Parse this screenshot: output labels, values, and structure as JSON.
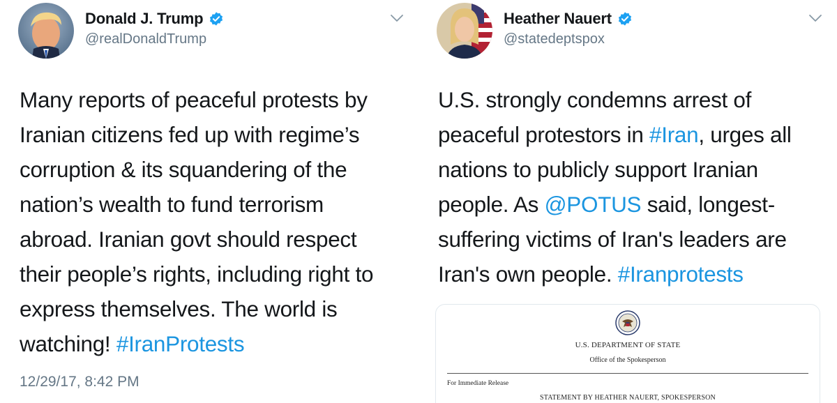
{
  "colors": {
    "link": "#1b95e0",
    "verified": "#1da1f2",
    "secondary_text": "#657786",
    "primary_text": "#14171a"
  },
  "left_tweet": {
    "display_name": "Donald J. Trump",
    "handle": "@realDonaldTrump",
    "avatar_icon": "profile-photo",
    "verified_icon": "verified-badge-icon",
    "menu_icon": "chevron-down-icon",
    "lines": [
      "Many reports of peaceful protests by",
      "Iranian citizens fed up with regime’s",
      "corruption & its squandering of the",
      "nation’s wealth to fund terrorism",
      "abroad. Iranian govt should respect",
      "their people’s rights, including right to",
      "express themselves. The world is",
      "watching!"
    ],
    "hashtag": "#IranProtests",
    "timestamp": "12/29/17, 8:42 PM"
  },
  "right_tweet": {
    "display_name": "Heather Nauert",
    "handle": "@statedeptspox",
    "avatar_icon": "profile-photo",
    "verified_icon": "verified-badge-icon",
    "menu_icon": "chevron-down-icon",
    "line1": "U.S. strongly condemns arrest of",
    "line2_pre": "peaceful protestors in ",
    "line2_link": "#Iran",
    "line2_post": ", urges all",
    "line3": "nations to publicly support Iranian",
    "line4_pre": "people. As ",
    "line4_link": "@POTUS",
    "line4_post": " said, longest-",
    "line5": "suffering victims of Iran's leaders are",
    "line6_pre": "Iran's own people. ",
    "line6_link": "#Iranprotests",
    "document": {
      "seal_icon": "state-department-seal-icon",
      "department": "U.S. DEPARTMENT OF STATE",
      "office": "Office of the Spokesperson",
      "release": "For Immediate Release",
      "statement": "STATEMENT BY HEATHER NAUERT, SPOKESPERSON"
    }
  }
}
